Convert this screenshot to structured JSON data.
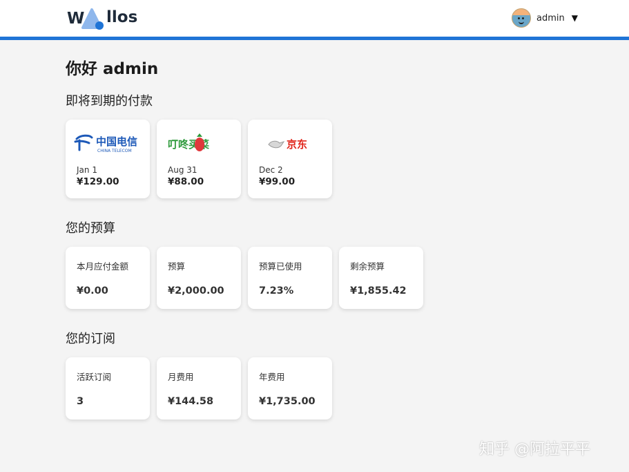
{
  "header": {
    "logo_text": "llos",
    "username": "admin",
    "caret": "▼",
    "colors": {
      "accent": "#1f74d6"
    }
  },
  "main": {
    "greeting": "你好 admin",
    "upcoming_title": "即将到期的付款",
    "upcoming": [
      {
        "logo": "china-telecom-logo",
        "logo_cn": "中国电信",
        "logo_en": "CHINA TELECOM",
        "date": "Jan 1",
        "price": "¥129.00"
      },
      {
        "logo": "dingdong-logo",
        "logo_cn": "叮咚买菜",
        "date": "Aug 31",
        "price": "¥88.00"
      },
      {
        "logo": "jd-logo",
        "logo_cn": "京东",
        "date": "Dec 2",
        "price": "¥99.00"
      }
    ],
    "budget_title": "您的预算",
    "budget": [
      {
        "label": "本月应付金额",
        "value": "¥0.00"
      },
      {
        "label": "预算",
        "value": "¥2,000.00"
      },
      {
        "label": "预算已使用",
        "value": "7.23%"
      },
      {
        "label": "剩余预算",
        "value": "¥1,855.42"
      }
    ],
    "subs_title": "您的订阅",
    "subscriptions": [
      {
        "label": "活跃订阅",
        "value": "3"
      },
      {
        "label": "月费用",
        "value": "¥144.58"
      },
      {
        "label": "年费用",
        "value": "¥1,735.00"
      }
    ]
  },
  "watermark": "知乎 @阿拉平平"
}
